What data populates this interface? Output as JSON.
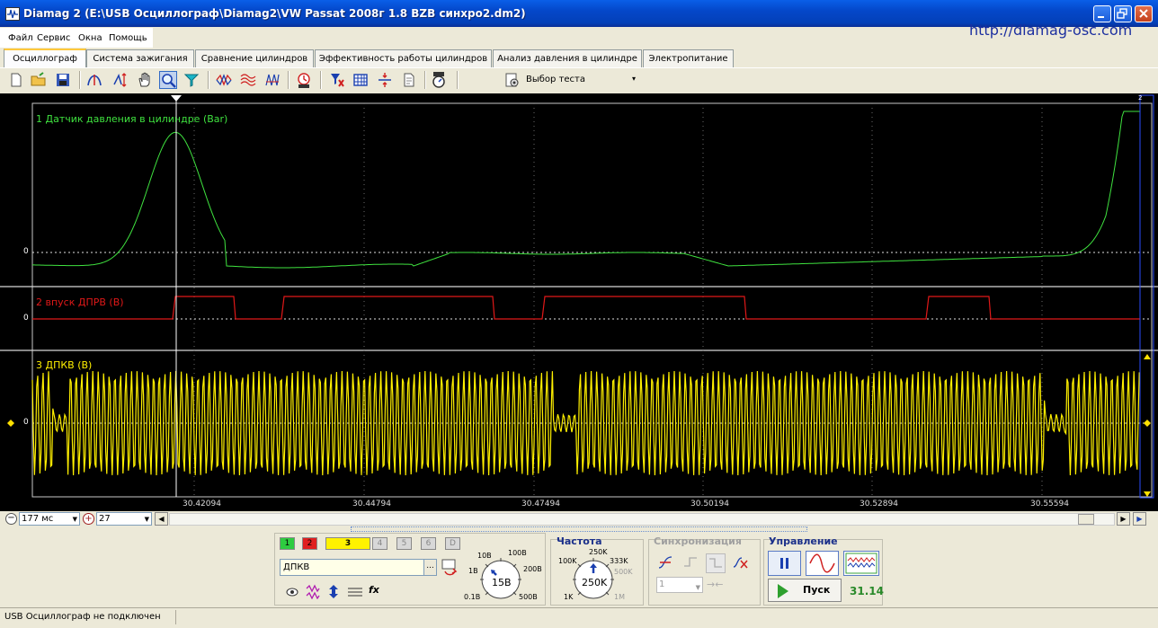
{
  "window": {
    "title": "Diamag 2 (E:\\USB Осциллограф\\Diamag2\\VW Passat 2008г 1.8 BZB синхро2.dm2)",
    "website": "http://diamag-osc.com"
  },
  "menu": [
    "Файл",
    "Сервис",
    "Окна",
    "Помощь"
  ],
  "tabs": [
    {
      "label": "Осциллограф",
      "active": true
    },
    {
      "label": "Система зажигания"
    },
    {
      "label": "Сравнение цилиндров"
    },
    {
      "label": "Эффективность работы цилиндров"
    },
    {
      "label": "Анализ давления в цилиндре"
    },
    {
      "label": "Электропитание"
    }
  ],
  "toolbar": {
    "icons": [
      "new-file-icon",
      "open-folder-icon",
      "save-icon",
      "autoscale-icon",
      "cursor-measure-icon",
      "hand-pan-icon",
      "zoom-icon",
      "filter-icon",
      "wave-a-icon",
      "wave-b-icon",
      "wave-c-icon",
      "auto-capture-icon",
      "channel-filter-icon",
      "grid-icon",
      "split-icon",
      "page-icon",
      "auto-timer-icon"
    ],
    "test_select": "Выбор теста"
  },
  "scope": {
    "channels": [
      {
        "label": "1 Датчик давления в цилиндре (Bar)",
        "color": "#3FE23F"
      },
      {
        "label": "2 впуск ДПРВ (В)",
        "color": "#E01818"
      },
      {
        "label": "3 ДПКВ (В)",
        "color": "#FFF000"
      }
    ],
    "zero_label": "0",
    "x_ticks": [
      "30.42094",
      "30.44794",
      "30.47494",
      "30.50194",
      "30.52894",
      "30.55594"
    ],
    "page_marker": "2"
  },
  "lower": {
    "timebase": "177 мс",
    "offset_value": "27"
  },
  "channel_panel": {
    "buttons": [
      "1",
      "2",
      "3",
      "4",
      "5",
      "6",
      "D"
    ],
    "button_colors": [
      "#2ECC40",
      "#E02020",
      "#FFF200",
      "#D8D8D8",
      "#D8D8D8",
      "#D8D8D8",
      "#D8D8D8"
    ],
    "sensor_name": "ДПКВ",
    "sensor_more": "...",
    "knob_labels": [
      "10В",
      "100В",
      "1В",
      "200В",
      "0.1В",
      "500В"
    ],
    "knob_value": "15В"
  },
  "frequency_panel": {
    "title": "Частота",
    "knob_labels": [
      "250K",
      "100K",
      "333K",
      "500K",
      "1K",
      "1M"
    ],
    "knob_value": "250K"
  },
  "sync_panel": {
    "title": "Синхронизация",
    "channel_value": "1"
  },
  "control_panel": {
    "title": "Управление",
    "start_label": "Пуск",
    "fps_value": "31.14"
  },
  "status": {
    "text": "USB Осциллограф не подключен"
  }
}
